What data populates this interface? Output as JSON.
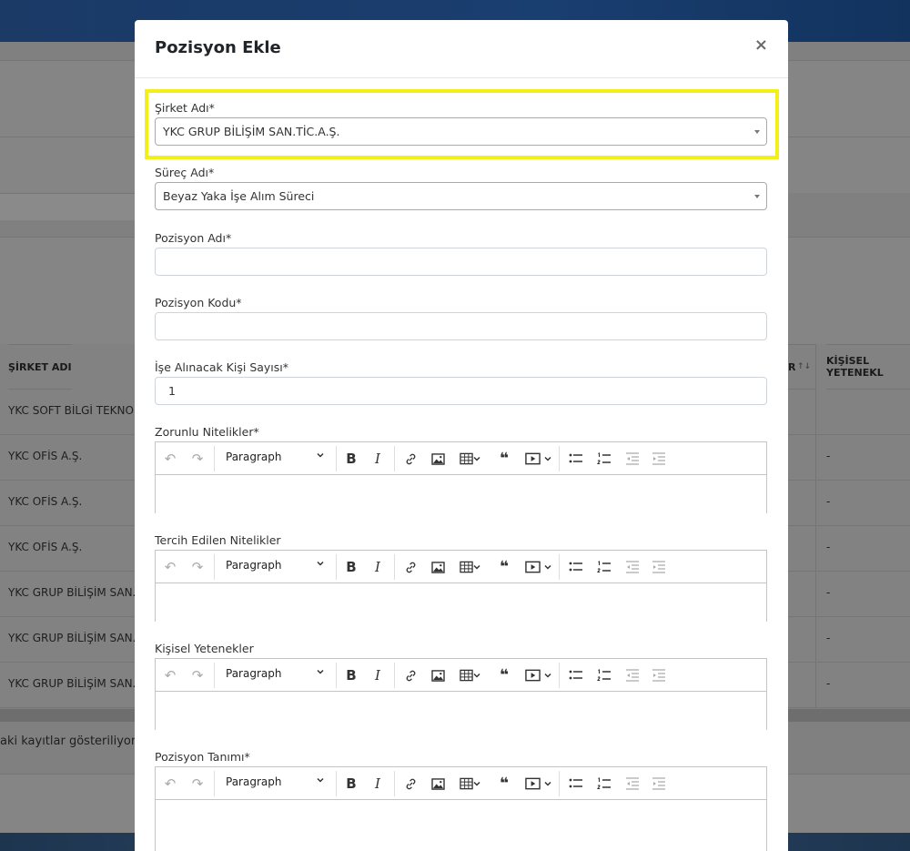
{
  "background": {
    "table": {
      "columns": [
        "ŞİRKET ADI",
        "R",
        "KİŞİSEL YETENEKL"
      ],
      "rows": [
        {
          "company": "YKC SOFT BİLGİ TEKNOLO",
          "skills": ""
        },
        {
          "company": "YKC OFİS A.Ş.",
          "skills": "-"
        },
        {
          "company": "YKC OFİS A.Ş.",
          "skills": "-"
        },
        {
          "company": "YKC OFİS A.Ş.",
          "skills": "-"
        },
        {
          "company": "YKC GRUP BİLİŞİM SAN.T",
          "skills": "-"
        },
        {
          "company": "YKC GRUP BİLİŞİM SAN.T",
          "skills": "-"
        },
        {
          "company": "YKC GRUP BİLİŞİM SAN.T",
          "skills": "-"
        }
      ],
      "sort_icon": "↑↓"
    },
    "info_text": "aki kayıtlar gösteriliyor"
  },
  "modal": {
    "title": "Pozisyon Ekle",
    "close_label": "×",
    "fields": {
      "company": {
        "label": "Şirket Adı*",
        "value": "YKC GRUP BİLİŞİM SAN.TİC.A.Ş."
      },
      "process": {
        "label": "Süreç Adı*",
        "value": "Beyaz Yaka İşe Alım Süreci"
      },
      "position_name": {
        "label": "Pozisyon Adı*",
        "value": ""
      },
      "position_code": {
        "label": "Pozisyon Kodu*",
        "value": ""
      },
      "headcount": {
        "label": "İşe Alınacak Kişi Sayısı*",
        "value": "1"
      }
    },
    "editors": [
      {
        "label": "Zorunlu Nitelikler*"
      },
      {
        "label": "Tercih Edilen Nitelikler"
      },
      {
        "label": "Kişisel Yetenekler"
      },
      {
        "label": "Pozisyon Tanımı*"
      }
    ],
    "toolbar": {
      "paragraph": "Paragraph",
      "undo": "↶",
      "redo": "↷",
      "bold": "B",
      "italic": "I",
      "blockquote": "❝",
      "caret": "⌄"
    },
    "highlight_color": "#f3ef1a"
  }
}
